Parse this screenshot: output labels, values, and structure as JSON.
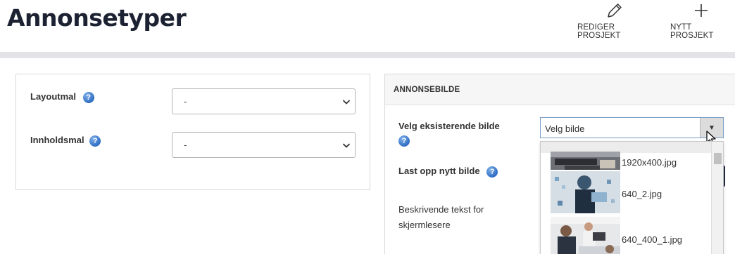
{
  "page": {
    "title": "Annonsetyper"
  },
  "header": {
    "actions": [
      {
        "label": "REDIGER PROSJEKT",
        "icon": "pencil-icon"
      },
      {
        "label": "NYTT PROSJEKT",
        "icon": "plus-icon"
      }
    ]
  },
  "left_panel": {
    "fields": [
      {
        "label": "Layoutmal",
        "value": "-"
      },
      {
        "label": "Innholdsmal",
        "value": "-"
      }
    ]
  },
  "right_panel": {
    "title": "ANNONSEBILDE",
    "existing_image": {
      "label": "Velg eksisterende bilde",
      "value": "Velg bilde",
      "options": [
        "1920x400.jpg",
        "640_2.jpg",
        "640_400_1.jpg"
      ]
    },
    "upload_label": "Last opp nytt bilde",
    "description_label": "Beskrivende tekst for skjermlesere"
  },
  "colors": {
    "accent": "#2f6ec4",
    "title": "#1d2233",
    "divider": "#e4e4e8"
  }
}
